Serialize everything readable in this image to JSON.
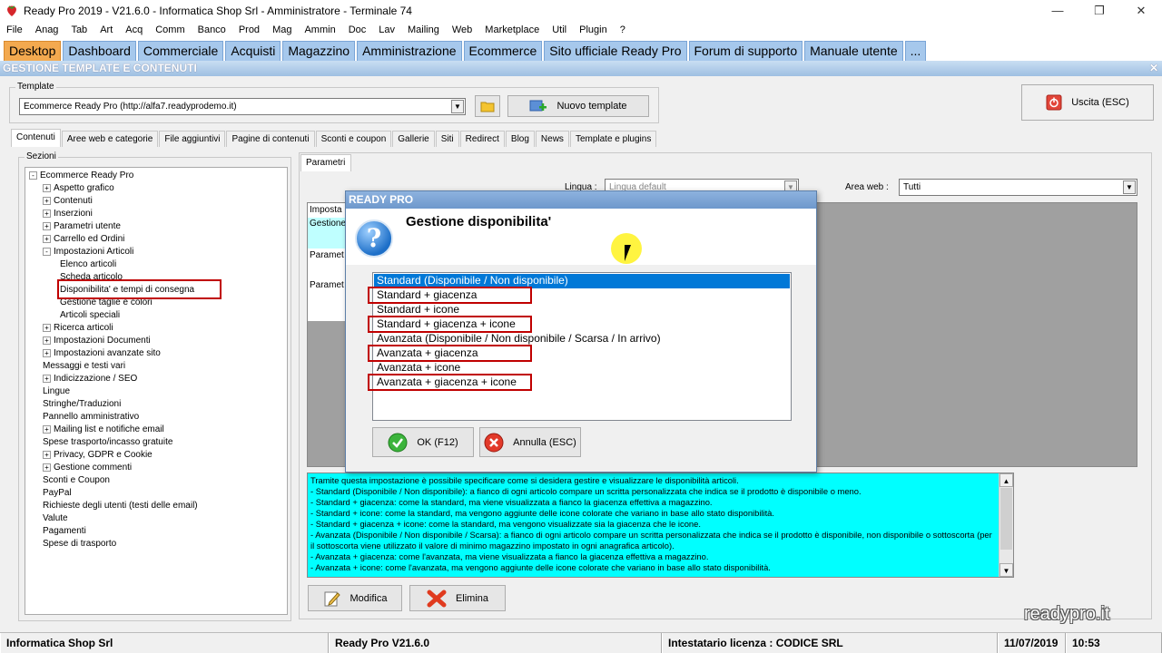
{
  "window": {
    "title": "Ready Pro 2019 - V21.6.0 - Informatica Shop Srl - Amministratore - Terminale 74",
    "controls": {
      "minimize": "—",
      "restore": "❐",
      "close": "✕"
    }
  },
  "menu": [
    "File",
    "Anag",
    "Tab",
    "Art",
    "Acq",
    "Comm",
    "Banco",
    "Prod",
    "Mag",
    "Ammin",
    "Doc",
    "Lav",
    "Mailing",
    "Web",
    "Marketplace",
    "Util",
    "Plugin",
    "?"
  ],
  "tabs": [
    "Desktop",
    "Dashboard",
    "Commerciale",
    "Acquisti",
    "Magazzino",
    "Amministrazione",
    "Ecommerce",
    "Sito ufficiale Ready Pro",
    "Forum di supporto",
    "Manuale utente",
    "..."
  ],
  "section_title": "GESTIONE TEMPLATE E CONTENUTI",
  "section_close": "✕",
  "template": {
    "label": "Template",
    "value": "Ecommerce Ready Pro (http://alfa7.readyprodemo.it)",
    "new_button": "Nuovo template"
  },
  "exit_button": "Uscita (ESC)",
  "subtabs": [
    "Contenuti",
    "Aree web e categorie",
    "File aggiuntivi",
    "Pagine di contenuti",
    "Sconti e coupon",
    "Gallerie",
    "Siti",
    "Redirect",
    "Blog",
    "News",
    "Template e plugins"
  ],
  "sections": {
    "label": "Sezioni",
    "tree": [
      {
        "text": "Ecommerce Ready Pro",
        "level": 0,
        "toggle": "-"
      },
      {
        "text": "Aspetto grafico",
        "level": 1,
        "toggle": "+"
      },
      {
        "text": "Contenuti",
        "level": 1,
        "toggle": "+"
      },
      {
        "text": "Inserzioni",
        "level": 1,
        "toggle": "+"
      },
      {
        "text": "Parametri utente",
        "level": 1,
        "toggle": "+"
      },
      {
        "text": "Carrello ed Ordini",
        "level": 1,
        "toggle": "+"
      },
      {
        "text": "Impostazioni Articoli",
        "level": 1,
        "toggle": "-"
      },
      {
        "text": "Elenco articoli",
        "level": 2,
        "toggle": ""
      },
      {
        "text": "Scheda articolo",
        "level": 2,
        "toggle": ""
      },
      {
        "text": "Disponibilita' e tempi di consegna",
        "level": 2,
        "toggle": "",
        "selected": true
      },
      {
        "text": "Gestione taglie e colori",
        "level": 2,
        "toggle": ""
      },
      {
        "text": "Articoli speciali",
        "level": 2,
        "toggle": ""
      },
      {
        "text": "Ricerca articoli",
        "level": 1,
        "toggle": "+"
      },
      {
        "text": "Impostazioni Documenti",
        "level": 1,
        "toggle": "+"
      },
      {
        "text": "Impostazioni avanzate sito",
        "level": 1,
        "toggle": "+"
      },
      {
        "text": "Messaggi e testi vari",
        "level": 1,
        "toggle": ""
      },
      {
        "text": "Indicizzazione / SEO",
        "level": 1,
        "toggle": "+"
      },
      {
        "text": "Lingue",
        "level": 1,
        "toggle": ""
      },
      {
        "text": "Stringhe/Traduzioni",
        "level": 1,
        "toggle": ""
      },
      {
        "text": "Pannello amministrativo",
        "level": 1,
        "toggle": ""
      },
      {
        "text": "Mailing list e notifiche email",
        "level": 1,
        "toggle": "+"
      },
      {
        "text": "Spese trasporto/incasso gratuite",
        "level": 1,
        "toggle": ""
      },
      {
        "text": "Privacy, GDPR e Cookie",
        "level": 1,
        "toggle": "+"
      },
      {
        "text": "Gestione commenti",
        "level": 1,
        "toggle": "+"
      },
      {
        "text": "Sconti e Coupon",
        "level": 1,
        "toggle": ""
      },
      {
        "text": "PayPal",
        "level": 1,
        "toggle": ""
      },
      {
        "text": "Richieste degli utenti (testi delle email)",
        "level": 1,
        "toggle": ""
      },
      {
        "text": "Valute",
        "level": 1,
        "toggle": ""
      },
      {
        "text": "Pagamenti",
        "level": 1,
        "toggle": ""
      },
      {
        "text": "Spese di trasporto",
        "level": 1,
        "toggle": ""
      }
    ]
  },
  "params": {
    "tab": "Parametri",
    "lingua_label": "Lingua :",
    "lingua_value": "Lingua default",
    "area_label": "Area web :",
    "area_value": "Tutti",
    "grid_cells": [
      "Imposta",
      "Gestione",
      "Paramet",
      "Paramet"
    ]
  },
  "description": [
    "Tramite questa impostazione è possibile specificare come si desidera gestire e visualizzare le disponibilità articoli.",
    "- Standard (Disponibile / Non disponibile): a fianco di ogni articolo compare un scritta personalizzata che indica se il prodotto è disponibile o meno.",
    "- Standard + giacenza: come la standard, ma viene visualizzata a fianco la giacenza effettiva a magazzino.",
    "- Standard + icone: come la standard, ma vengono aggiunte delle icone colorate che variano in base allo stato disponibilità.",
    "- Standard + giacenza + icone: come la standard, ma vengono visualizzate sia la giacenza che le icone.",
    "- Avanzata (Disponibile / Non disponibile / Scarsa): a fianco di ogni articolo compare un scritta personalizzata che indica se il prodotto è disponibile, non disponibile o sottoscorta (per il sottoscorta viene utilizzato il valore di minimo magazzino impostato in ogni anagrafica articolo).",
    "- Avanzata + giacenza: come l'avanzata, ma viene visualizzata a fianco la giacenza effettiva a magazzino.",
    "- Avanzata + icone: come l'avanzata, ma vengono aggiunte delle icone colorate che variano in base allo stato disponibilità."
  ],
  "actions": {
    "modify": "Modifica",
    "delete": "Elimina"
  },
  "dialog": {
    "title": "READY PRO",
    "icon": "?",
    "heading": "Gestione disponibilita'",
    "options": [
      "Standard (Disponibile / Non disponibile)",
      "Standard + giacenza",
      "Standard + icone",
      "Standard + giacenza + icone",
      "Avanzata (Disponibile / Non disponibile / Scarsa / In arrivo)",
      "Avanzata + giacenza",
      "Avanzata + icone",
      "Avanzata + giacenza + icone"
    ],
    "selected_index": 0,
    "ok_button": "OK (F12)",
    "cancel_button": "Annulla (ESC)"
  },
  "watermark": "readypro.it",
  "status": [
    "Informatica Shop Srl",
    "Ready Pro V21.6.0",
    "Intestatario licenza : CODICE SRL",
    "11/07/2019",
    "10:53"
  ],
  "colors": {
    "active_tab": "#f3a94f",
    "tab": "#a6c8ec",
    "description_bg": "#00ffff",
    "selection": "#0078d7",
    "highlight": "#c00000"
  }
}
